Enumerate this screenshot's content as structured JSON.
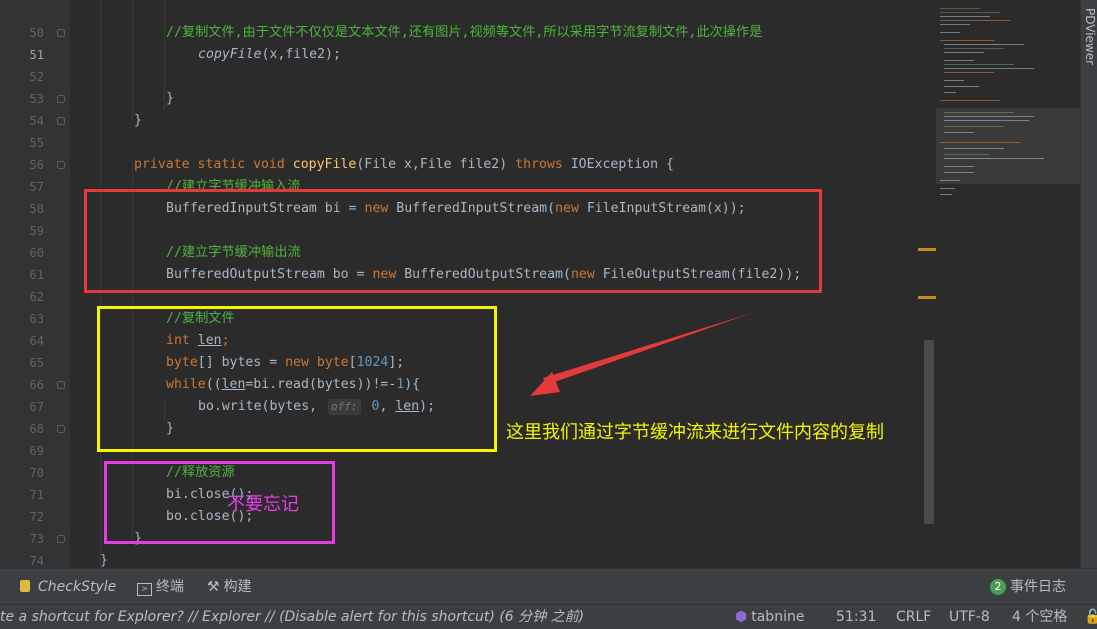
{
  "editor": {
    "lines": [
      {
        "n": "50",
        "segs": [
          {
            "t": "//复制文件,由于文件不仅仅是文本文件,还有图片,视频等文件,所以采用字节流复制文件,此次操作是",
            "c": "cmg"
          }
        ]
      },
      {
        "n": "51",
        "segs": [
          {
            "t": "copyFile",
            "c": "it"
          },
          {
            "t": "(x,file2);"
          }
        ]
      },
      {
        "n": "52",
        "segs": []
      },
      {
        "n": "53",
        "segs": [
          {
            "t": "}"
          }
        ]
      },
      {
        "n": "54",
        "segs": [
          {
            "t": "}"
          }
        ]
      },
      {
        "n": "55",
        "segs": []
      },
      {
        "n": "56",
        "segs": [
          {
            "t": "private static void ",
            "c": "kw"
          },
          {
            "t": "copyFile",
            "c": "fn"
          },
          {
            "t": "(File x,File file2) "
          },
          {
            "t": "throws ",
            "c": "kw"
          },
          {
            "t": "IOException {"
          }
        ]
      },
      {
        "n": "57",
        "segs": [
          {
            "t": "//建立字节缓冲输入流",
            "c": "cmg"
          }
        ]
      },
      {
        "n": "58",
        "segs": [
          {
            "t": "BufferedInputStream bi = "
          },
          {
            "t": "new ",
            "c": "kw"
          },
          {
            "t": "BufferedInputStream("
          },
          {
            "t": "new ",
            "c": "kw"
          },
          {
            "t": "FileInputStream(x));"
          }
        ]
      },
      {
        "n": "59",
        "segs": []
      },
      {
        "n": "60",
        "segs": [
          {
            "t": "//建立字节缓冲输出流",
            "c": "cmg"
          }
        ]
      },
      {
        "n": "61",
        "segs": [
          {
            "t": "BufferedOutputStream bo = "
          },
          {
            "t": "new ",
            "c": "kw"
          },
          {
            "t": "BufferedOutputStream("
          },
          {
            "t": "new ",
            "c": "kw"
          },
          {
            "t": "FileOutputStream(file2));"
          }
        ]
      },
      {
        "n": "62",
        "segs": []
      },
      {
        "n": "63",
        "segs": [
          {
            "t": "//复制文件",
            "c": "cmg"
          }
        ]
      },
      {
        "n": "64",
        "segs": [
          {
            "t": "int ",
            "c": "kw"
          },
          {
            "t": "len",
            "c": "ul"
          },
          {
            "t": ";",
            "c": "kw"
          }
        ]
      },
      {
        "n": "65",
        "segs": [
          {
            "t": "byte",
            "c": "kw"
          },
          {
            "t": "[] bytes = "
          },
          {
            "t": "new ",
            "c": "kw"
          },
          {
            "t": "byte",
            "c": "kw"
          },
          {
            "t": "["
          },
          {
            "t": "1024",
            "c": "num"
          },
          {
            "t": "];"
          }
        ]
      },
      {
        "n": "66",
        "segs": [
          {
            "t": "while",
            "c": "kw"
          },
          {
            "t": "(("
          },
          {
            "t": "len",
            "c": "ul"
          },
          {
            "t": "=bi.read(bytes))!=-"
          },
          {
            "t": "1",
            "c": "num"
          },
          {
            "t": "){"
          }
        ]
      },
      {
        "n": "67",
        "segs": [
          {
            "t": "bo.write(bytes, "
          },
          {
            "t": "off:",
            "c": "hint"
          },
          {
            "t": " "
          },
          {
            "t": "0",
            "c": "num"
          },
          {
            "t": ", "
          },
          {
            "t": "len",
            "c": "ul"
          },
          {
            "t": ");"
          }
        ]
      },
      {
        "n": "68",
        "segs": [
          {
            "t": "}"
          }
        ]
      },
      {
        "n": "69",
        "segs": []
      },
      {
        "n": "70",
        "segs": [
          {
            "t": "//释放资源",
            "c": "cmg"
          }
        ]
      },
      {
        "n": "71",
        "segs": [
          {
            "t": "bi.close();"
          }
        ]
      },
      {
        "n": "72",
        "segs": [
          {
            "t": "bo.close();"
          }
        ]
      },
      {
        "n": "73",
        "segs": [
          {
            "t": "}"
          }
        ]
      },
      {
        "n": "74",
        "segs": [
          {
            "t": "}"
          }
        ]
      }
    ]
  },
  "annotations": {
    "arrow_text": "这里我们通过字节缓冲流来进行文件内容的复制",
    "reminder_text": "不要忘记",
    "colors": {
      "red": "#e5393b",
      "yellow": "#f5f500",
      "magenta": "#e63ce6"
    }
  },
  "side_tab": {
    "label": "PDViewer"
  },
  "toolwindows": {
    "checkstyle": "CheckStyle",
    "terminal": "终端",
    "build": "构建",
    "event_log": "事件日志",
    "event_count": "2"
  },
  "status": {
    "message": "te a shortcut for Explorer? // Explorer // (Disable alert for this shortcut) (6 分钟 之前)",
    "tabnine": "tabnine",
    "position": "51:31",
    "line_sep": "CRLF",
    "encoding": "UTF-8",
    "indent": "4 个空格"
  }
}
